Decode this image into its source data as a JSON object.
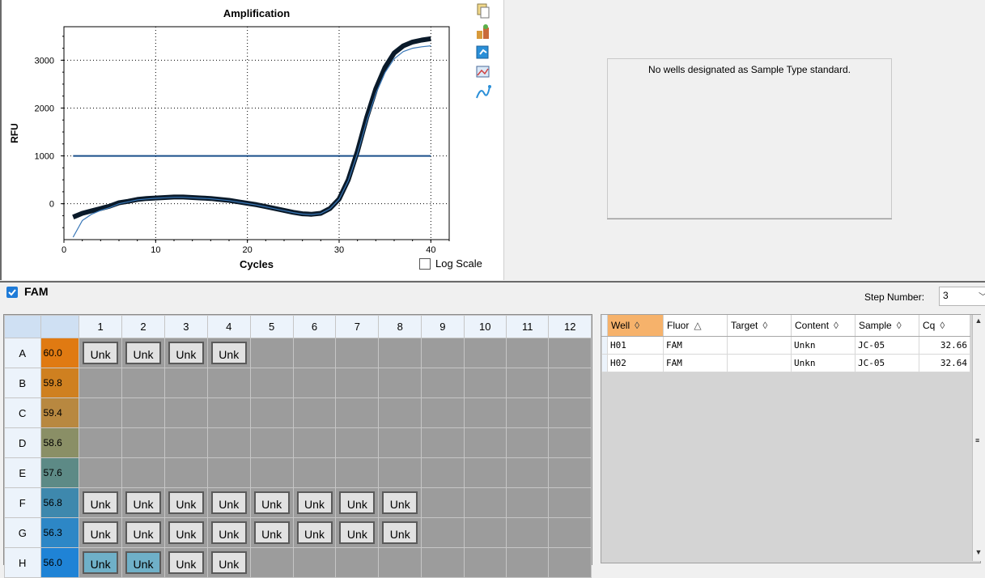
{
  "chart_data": {
    "type": "line",
    "title": "Amplification",
    "xlabel": "Cycles",
    "ylabel": "RFU",
    "xlim": [
      0,
      42
    ],
    "ylim": [
      -750,
      3700
    ],
    "xticks": [
      0,
      10,
      20,
      30,
      40
    ],
    "yticks": [
      0,
      1000,
      2000,
      3000
    ],
    "grid": true,
    "threshold": 1000,
    "series": [
      {
        "x": [
          1,
          2,
          3,
          4,
          5,
          6,
          7,
          8,
          9,
          10,
          11,
          12,
          13,
          14,
          15,
          16,
          17,
          18,
          19,
          20,
          21,
          22,
          23,
          24,
          25,
          26,
          27,
          28,
          29,
          30,
          31,
          32,
          33,
          34,
          35,
          36,
          37,
          38,
          39,
          40
        ],
        "y": [
          -280,
          -200,
          -150,
          -100,
          -50,
          20,
          50,
          90,
          110,
          120,
          130,
          140,
          140,
          130,
          120,
          110,
          90,
          70,
          40,
          10,
          -20,
          -60,
          -100,
          -140,
          -180,
          -210,
          -220,
          -200,
          -100,
          100,
          500,
          1100,
          1800,
          2400,
          2850,
          3150,
          3300,
          3380,
          3420,
          3450
        ]
      },
      {
        "x": [
          1,
          2,
          3,
          4,
          5,
          6,
          7,
          8,
          9,
          10,
          11,
          12,
          13,
          14,
          15,
          16,
          17,
          18,
          19,
          20,
          21,
          22,
          23,
          24,
          25,
          26,
          27,
          28,
          29,
          30,
          31,
          32,
          33,
          34,
          35,
          36,
          37,
          38,
          39,
          40
        ],
        "y": [
          -700,
          -350,
          -220,
          -140,
          -80,
          0,
          40,
          80,
          100,
          115,
          125,
          135,
          135,
          125,
          115,
          105,
          85,
          65,
          35,
          5,
          -25,
          -65,
          -105,
          -145,
          -185,
          -215,
          -225,
          -205,
          -105,
          95,
          480,
          1050,
          1720,
          2300,
          2740,
          3030,
          3180,
          3250,
          3280,
          3300
        ]
      }
    ]
  },
  "chart_ui": {
    "log_scale_label": "Log Scale",
    "log_scale_checked": false
  },
  "toolbar_icons": [
    "copy-icon",
    "export-icon",
    "refresh-icon",
    "chart-image-icon",
    "curve-icon"
  ],
  "standard_panel": {
    "message": "No wells designated as Sample Type standard."
  },
  "fluor_bar": {
    "label": "FAM",
    "checked": true,
    "step_label": "Step Number:",
    "step_value": "3"
  },
  "plate": {
    "columns": [
      "1",
      "2",
      "3",
      "4",
      "5",
      "6",
      "7",
      "8",
      "9",
      "10",
      "11",
      "12"
    ],
    "rows": [
      {
        "label": "A",
        "temp": "60.0",
        "temp_color": "#e07a12",
        "wells": [
          "Unk",
          "Unk",
          "Unk",
          "Unk",
          "",
          "",
          "",
          "",
          "",
          "",
          "",
          ""
        ]
      },
      {
        "label": "B",
        "temp": "59.8",
        "temp_color": "#cf8020",
        "wells": [
          "",
          "",
          "",
          "",
          "",
          "",
          "",
          "",
          "",
          "",
          "",
          ""
        ]
      },
      {
        "label": "C",
        "temp": "59.4",
        "temp_color": "#b88840",
        "wells": [
          "",
          "",
          "",
          "",
          "",
          "",
          "",
          "",
          "",
          "",
          "",
          ""
        ]
      },
      {
        "label": "D",
        "temp": "58.6",
        "temp_color": "#8a8f66",
        "wells": [
          "",
          "",
          "",
          "",
          "",
          "",
          "",
          "",
          "",
          "",
          "",
          ""
        ]
      },
      {
        "label": "E",
        "temp": "57.6",
        "temp_color": "#5d8a86",
        "wells": [
          "",
          "",
          "",
          "",
          "",
          "",
          "",
          "",
          "",
          "",
          "",
          ""
        ]
      },
      {
        "label": "F",
        "temp": "56.8",
        "temp_color": "#3e88ad",
        "wells": [
          "Unk",
          "Unk",
          "Unk",
          "Unk",
          "Unk",
          "Unk",
          "Unk",
          "Unk",
          "",
          "",
          "",
          ""
        ]
      },
      {
        "label": "G",
        "temp": "56.3",
        "temp_color": "#2d87c6",
        "wells": [
          "Unk",
          "Unk",
          "Unk",
          "Unk",
          "Unk",
          "Unk",
          "Unk",
          "Unk",
          "",
          "",
          "",
          ""
        ]
      },
      {
        "label": "H",
        "temp": "56.0",
        "temp_color": "#1f83d6",
        "wells": [
          "Unk",
          "Unk",
          "Unk",
          "Unk",
          "",
          "",
          "",
          "",
          "",
          "",
          "",
          ""
        ],
        "selected": [
          0,
          1
        ]
      }
    ]
  },
  "results_grid": {
    "headers": [
      "Well",
      "Fluor",
      "Target",
      "Content",
      "Sample",
      "Cq"
    ],
    "sort_icons": [
      "◊",
      "△",
      "◊",
      "◊",
      "◊",
      "◊"
    ],
    "rows": [
      [
        "H01",
        "FAM",
        "",
        "Unkn",
        "JC-05",
        "32.66"
      ],
      [
        "H02",
        "FAM",
        "",
        "Unkn",
        "JC-05",
        "32.64"
      ]
    ]
  }
}
